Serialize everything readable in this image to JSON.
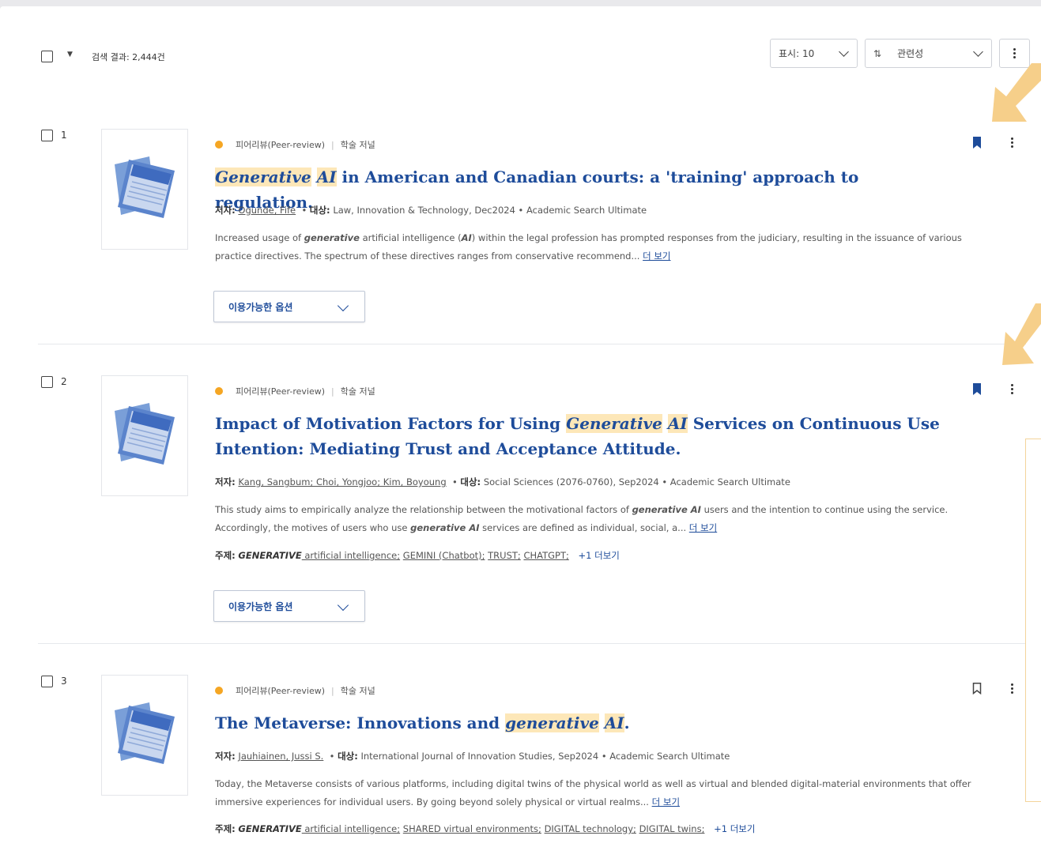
{
  "toolbar": {
    "result_count": "검색 결과: 2,444건",
    "display_label": "표시: 10",
    "sort_label": "관련성",
    "sort_icon": "sort-icon"
  },
  "results": [
    {
      "number": "1",
      "peer_review": "피어리뷰(Peer-review)",
      "doc_type": "학술 저널",
      "title_hl1": "Generative",
      "title_hl2": "AI",
      "title_rest": " in American and Canadian courts: a 'training' approach to regulation.",
      "author_label": "저자:",
      "authors": "Ogunde, Fife",
      "source_label": "대상:",
      "source": "Law, Innovation & Technology, Dec2024 • Academic Search Ultimate",
      "abstract_1": "Increased usage of ",
      "abstract_hl1": "generative",
      "abstract_2": " artificial intelligence (",
      "abstract_hl2": "AI",
      "abstract_3": ") within the legal profession has prompted responses from the judiciary, resulting in the issuance of various practice directives. The spectrum of these directives ranges from conservative recommend...",
      "more": "더 보기",
      "avail_label": "이용가능한 옵션",
      "bookmarked": true
    },
    {
      "number": "2",
      "peer_review": "피어리뷰(Peer-review)",
      "doc_type": "학술 저널",
      "title_1": "Impact of Motivation Factors for Using ",
      "title_hl1": "Generative",
      "title_hl2": "AI",
      "title_rest": " Services on Continuous Use Intention: Mediating Trust and Acceptance Attitude.",
      "author_label": "저자:",
      "authors": "Kang, Sangbum; Choi, Yongjoo; Kim, Boyoung",
      "source_label": "대상:",
      "source": "Social Sciences (2076-0760), Sep2024 • Academic Search Ultimate",
      "abstract_1": "This study aims to empirically analyze the relationship between the motivational factors of ",
      "abstract_hl1": "generative AI",
      "abstract_2": " users and the intention to continue using the service. Accordingly, the motives of users who use ",
      "abstract_hl2": "generative AI",
      "abstract_3": " services are defined as individual, social, a...",
      "more": "더 보기",
      "subject_label": "주제:",
      "subject_gen": "GENERATIVE",
      "subject_1": " artificial intelligence;",
      "subject_2": "GEMINI (Chatbot);",
      "subject_3": "TRUST;",
      "subject_4": "CHATGPT;",
      "subject_more": "+1 더보기",
      "avail_label": "이용가능한 옵션",
      "bookmarked": true
    },
    {
      "number": "3",
      "peer_review": "피어리뷰(Peer-review)",
      "doc_type": "학술 저널",
      "title_1": "The Metaverse: Innovations and ",
      "title_hl1": "generative",
      "title_hl2": "AI",
      "title_rest": ".",
      "author_label": "저자:",
      "authors": "Jauhiainen, Jussi S.",
      "source_label": "대상:",
      "source": "International Journal of Innovation Studies, Sep2024 • Academic Search Ultimate",
      "abstract_1": "Today, the Metaverse consists of various platforms, including digital twins of the physical world as well as virtual and blended digital-material environments that offer immersive experiences for individual users. By going beyond solely physical or virtual realms...",
      "more": "더 보기",
      "subject_label": "주제:",
      "subject_gen": "GENERATIVE",
      "subject_1": " artificial intelligence;",
      "subject_2": "SHARED virtual environments;",
      "subject_3": "DIGITAL technology;",
      "subject_4": "DIGITAL twins;",
      "subject_more": "+1 더보기",
      "bookmarked": false
    }
  ],
  "colors": {
    "title": "#1e4c9a",
    "highlight": "#fde7b8",
    "peer_dot": "#f5a623",
    "annotation": "#f6cf8a"
  }
}
